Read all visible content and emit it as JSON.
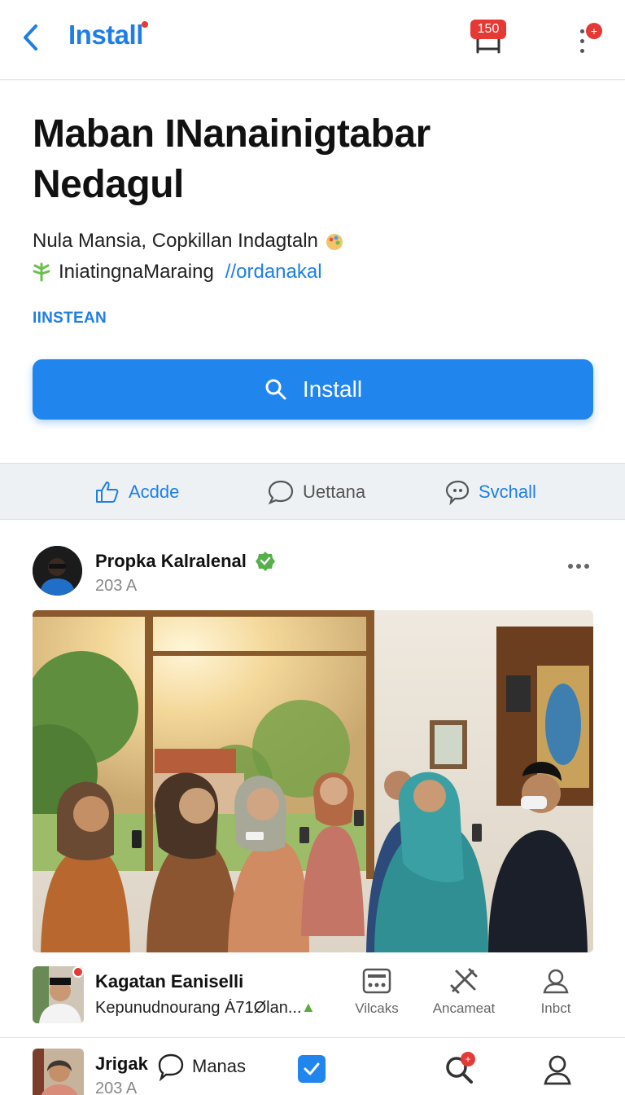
{
  "topbar": {
    "title": "Install",
    "badge": "150",
    "menu_badge": "+"
  },
  "app": {
    "title": "Maban INanainigtabar Nedagul",
    "subtitle_line1": "Nula Mansia, Copkillan Indagtaln",
    "subtitle_line2": "IniatingnaMaraing",
    "subtitle_link": "//ordanakal",
    "section_label": "IINSTEAN",
    "install_label": "Install"
  },
  "actions": [
    {
      "label": "Acdde",
      "icon": "thumbs-up-icon"
    },
    {
      "label": "Uettana",
      "icon": "comment-icon"
    },
    {
      "label": "Svchall",
      "icon": "share-icon"
    }
  ],
  "post": {
    "author": "Propka Kalralenal",
    "time": "203 A",
    "image": "group-photo"
  },
  "row2": {
    "name": "Kagatan Eaniselli",
    "desc": "Kepunudnourang Á71Ølan...",
    "tabs": [
      {
        "label": "Vilcaks",
        "icon": "radio-icon"
      },
      {
        "label": "Ancameat",
        "icon": "tools-icon"
      },
      {
        "label": "Inbct",
        "icon": "person-icon"
      }
    ]
  },
  "row3": {
    "name": "Jrigak",
    "time": "203 A",
    "chat_label": "Manas",
    "search_badge": "+"
  },
  "colors": {
    "accent": "#1e7ee6",
    "button": "#2185ee",
    "alert": "#e53935",
    "strip": "#eef1f3"
  }
}
